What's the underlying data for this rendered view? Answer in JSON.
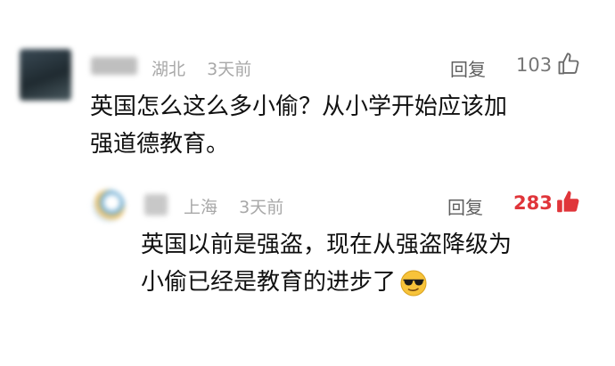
{
  "comment": {
    "location": "湖北",
    "time": "3天前",
    "reply_label": "回复",
    "likes": "103",
    "text_line1": "英国怎么这么多小偷？从小学开始应该加",
    "text_line2": "强道德教育。"
  },
  "reply": {
    "location": "上海",
    "time": "3天前",
    "reply_label": "回复",
    "likes": "283",
    "text_line1": "英国以前是强盗，现在从强盗降级为",
    "text_line2": "小偷已经是教育的进步了",
    "emoji": "smiling-face-with-sunglasses"
  },
  "colors": {
    "liked_accent": "#e0353a",
    "meta_gray": "#a8a8a8"
  },
  "icons": {
    "like_outline": "thumbs-up-outline-icon",
    "like_filled": "thumbs-up-filled-icon"
  }
}
